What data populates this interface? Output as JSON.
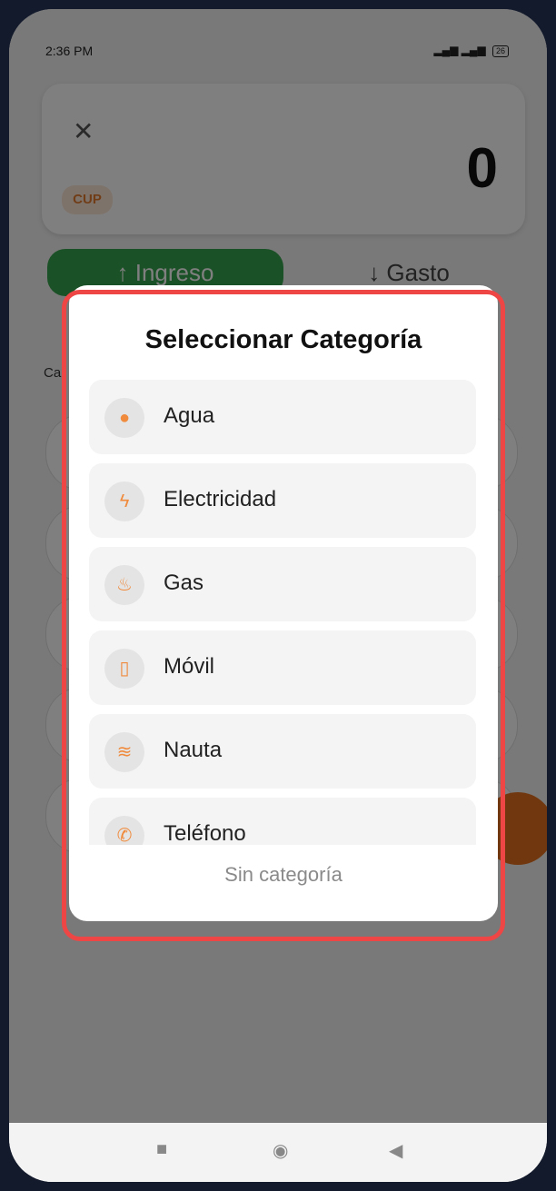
{
  "status_bar": {
    "time": "2:36 PM",
    "battery": "26"
  },
  "amount_card": {
    "amount": "0",
    "currency": "CUP"
  },
  "tabs": {
    "income": "↑ Ingreso",
    "expense": "↓ Gasto"
  },
  "dialog": {
    "title": "Seleccionar Categoría",
    "categories": [
      {
        "label": "Agua",
        "icon": "water-drop-icon"
      },
      {
        "label": "Electricidad",
        "icon": "lightning-icon"
      },
      {
        "label": "Gas",
        "icon": "flame-icon"
      },
      {
        "label": "Móvil",
        "icon": "mobile-phone-icon"
      },
      {
        "label": "Nauta",
        "icon": "wifi-icon"
      },
      {
        "label": "Teléfono",
        "icon": "phone-icon"
      }
    ],
    "no_category": "Sin categoría"
  },
  "colors": {
    "accent": "#f08a3c",
    "income_green": "#37a34c",
    "highlight": "#ee4545"
  }
}
